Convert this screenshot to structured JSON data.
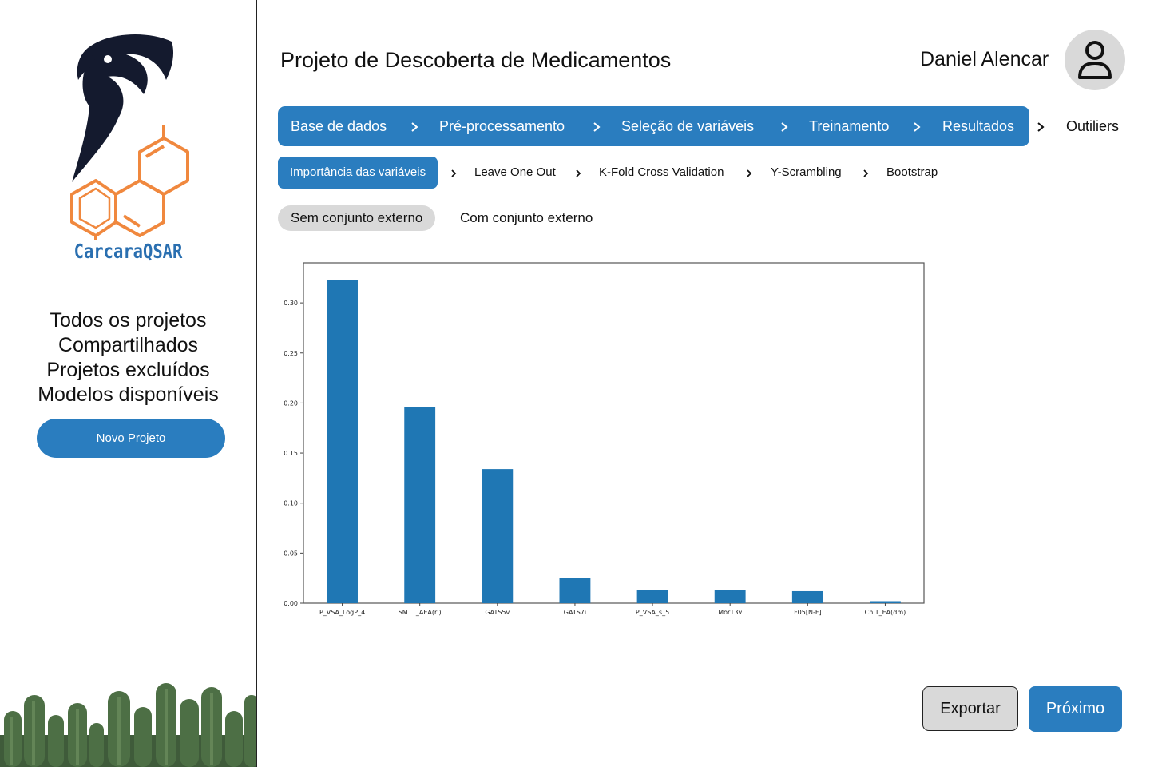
{
  "app": {
    "logo_text": "CarcaraQSAR",
    "title": "Projeto de Descoberta de Medicamentos"
  },
  "user": {
    "name": "Daniel Alencar",
    "avatar_icon": "user-icon"
  },
  "sidebar": {
    "items": [
      {
        "label": "Todos os projetos"
      },
      {
        "label": "Compartilhados"
      },
      {
        "label": "Projetos excluídos"
      },
      {
        "label": "Modelos disponíveis"
      }
    ],
    "new_project_label": "Novo Projeto"
  },
  "steps": [
    {
      "label": "Base de dados",
      "active": true
    },
    {
      "label": "Pré-processamento",
      "active": true
    },
    {
      "label": "Seleção de variáveis",
      "active": true
    },
    {
      "label": "Treinamento",
      "active": true
    },
    {
      "label": "Resultados",
      "active": true
    },
    {
      "label": "Outiliers",
      "active": false
    }
  ],
  "substeps": [
    {
      "label": "Importância das variáveis",
      "active": true
    },
    {
      "label": "Leave One Out",
      "active": false
    },
    {
      "label": "K-Fold Cross Validation",
      "active": false
    },
    {
      "label": "Y-Scrambling",
      "active": false
    },
    {
      "label": "Bootstrap",
      "active": false
    }
  ],
  "toggle": {
    "without_external": "Sem conjunto externo",
    "with_external": "Com conjunto externo",
    "selected": "without_external"
  },
  "colors": {
    "accent": "#2a7dbf",
    "bar": "#1f77b4",
    "logo_orange": "#f0883e",
    "logo_dark": "#141a2e"
  },
  "chart_data": {
    "type": "bar",
    "categories": [
      "P_VSA_LogP_4",
      "SM11_AEA(ri)",
      "GATS5v",
      "GATS7i",
      "P_VSA_s_5",
      "Mor13v",
      "F05[N-F]",
      "Chi1_EA(dm)"
    ],
    "values": [
      0.323,
      0.196,
      0.134,
      0.025,
      0.013,
      0.013,
      0.012,
      0.002
    ],
    "yticks": [
      "0.00",
      "0.05",
      "0.10",
      "0.15",
      "0.20",
      "0.25",
      "0.30"
    ],
    "ylim": [
      0,
      0.34
    ],
    "title": "",
    "xlabel": "",
    "ylabel": ""
  },
  "actions": {
    "export_label": "Exportar",
    "next_label": "Próximo"
  }
}
